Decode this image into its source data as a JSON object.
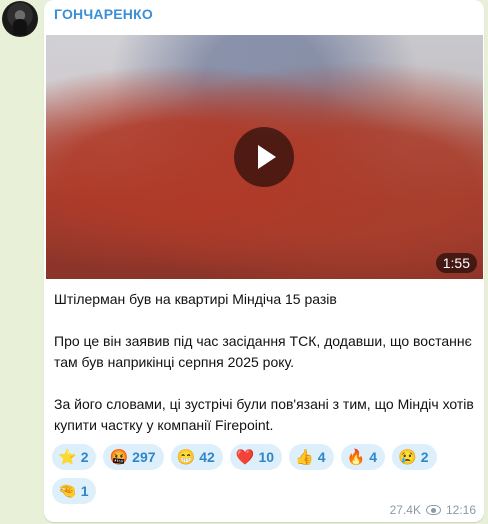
{
  "channel": {
    "author": "ГОНЧАРЕНКО"
  },
  "video": {
    "duration": "1:55"
  },
  "message": {
    "paragraphs": [
      "Штілерман був на квартирі Міндіча 15 разів",
      "Про це він заявив під час засідання ТСК, додавши, що востаннє там був наприкінці серпня 2025 року.",
      "За його словами, ці зустрічі були пов'язані з тим, що Міндіч хотів купити частку у компанії Firepoint."
    ]
  },
  "reactions": [
    {
      "emoji": "⭐",
      "count": "2",
      "icon": "star-icon"
    },
    {
      "emoji": "🤬",
      "count": "297",
      "icon": "cursing-face-icon"
    },
    {
      "emoji": "😁",
      "count": "42",
      "icon": "grin-icon"
    },
    {
      "emoji": "❤️",
      "count": "10",
      "icon": "heart-icon"
    },
    {
      "emoji": "👍",
      "count": "4",
      "icon": "thumbs-up-icon"
    },
    {
      "emoji": "🔥",
      "count": "4",
      "icon": "fire-icon"
    },
    {
      "emoji": "😢",
      "count": "2",
      "icon": "crying-face-icon"
    },
    {
      "emoji": "🤏",
      "count": "1",
      "icon": "pinching-hand-icon"
    }
  ],
  "meta": {
    "views": "27.4K",
    "time": "12:16"
  },
  "colors": {
    "accent": "#3a8fd6",
    "chip_bg": "#dceffb",
    "background": "#e9f0d8"
  }
}
